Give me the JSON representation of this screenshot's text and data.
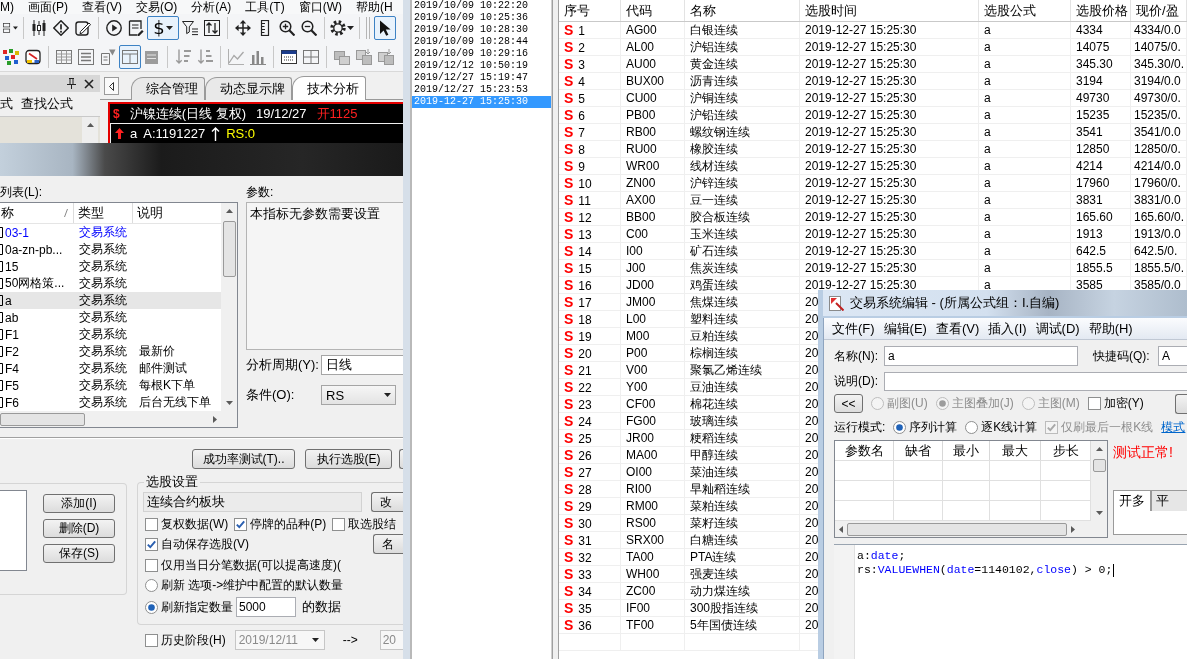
{
  "menu_bar": {
    "items": [
      "M)",
      "画面(P)",
      "查看(V)",
      "交易(O)",
      "分析(A)",
      "工具(T)",
      "窗口(W)",
      "帮助(H"
    ]
  },
  "toolbar_1": [
    {
      "pressed": false
    },
    {
      "pressed": false
    },
    {
      "pressed": false
    },
    {
      "pressed": false
    },
    {
      "pressed": false
    },
    {
      "pressed": false
    },
    {
      "label": "$",
      "pressed": true
    },
    {
      "pressed": false
    },
    {
      "pressed": false
    },
    {
      "pressed": false
    },
    {
      "pressed": false
    },
    {
      "pressed": false
    },
    {
      "pressed": false
    },
    {
      "pressed": false
    },
    {
      "pressed": true
    }
  ],
  "toolbar_2": [
    {
      "pressed": false
    },
    {
      "pressed": false
    },
    {
      "pressed": false
    },
    {
      "pressed": false
    },
    {
      "pressed": false
    },
    {
      "pressed": true
    },
    {
      "pressed": false
    },
    {
      "pressed": false
    },
    {
      "pressed": false
    },
    {
      "pressed": false
    },
    {
      "pressed": false
    },
    {
      "pressed": false
    },
    {
      "pressed": false
    },
    {
      "pressed": false
    },
    {
      "pressed": false
    },
    {
      "pressed": false
    }
  ],
  "side_panel": {
    "labels": [
      "式",
      "查找公式"
    ]
  },
  "tabs": [
    {
      "label": "综合管理",
      "selected": false
    },
    {
      "label": "动态显示牌",
      "selected": false
    },
    {
      "label": "技术分析",
      "selected": true
    }
  ],
  "chart_header": {
    "marker": "$",
    "title": "沪镍连续(日线 复权)",
    "date": "19/12/27",
    "open": "开1125",
    "formula": "a",
    "value": "A:1191227",
    "signal": "RS:0"
  },
  "formula_dialog": {
    "list_label": "列表(L):",
    "columns": [
      "称",
      "类型",
      "说明"
    ],
    "rows": [
      {
        "name": "03-1",
        "type": "交易系统",
        "current": true,
        "selected": false
      },
      {
        "name": "0a-zn-pb...",
        "type": "交易系统",
        "current": false,
        "selected": false
      },
      {
        "name": "15",
        "type": "交易系统",
        "current": false,
        "selected": false
      },
      {
        "name": "50网格策...",
        "type": "交易系统",
        "current": false,
        "selected": false
      },
      {
        "name": "a",
        "type": "交易系统",
        "current": false,
        "selected": true
      },
      {
        "name": "ab",
        "type": "交易系统",
        "current": false,
        "selected": false
      },
      {
        "name": "F1",
        "type": "交易系统",
        "current": false,
        "selected": false
      },
      {
        "name": "F2",
        "type": "交易系统",
        "note": "最新价",
        "current": false,
        "selected": false
      },
      {
        "name": "F4",
        "type": "交易系统",
        "note": "邮件测试",
        "current": false,
        "selected": false
      },
      {
        "name": "F5",
        "type": "交易系统",
        "note": "每根K下单",
        "current": false,
        "selected": false
      },
      {
        "name": "F6",
        "type": "交易系统",
        "note": "后台无线下单",
        "current": false,
        "selected": false
      }
    ],
    "params_label": "参数:",
    "params_text": "本指标无参数需要设置",
    "period": {
      "label": "分析周期(Y):",
      "value": "日线"
    },
    "condition": {
      "label": "条件(O):",
      "value": "RS"
    },
    "actions": [
      "成功率测试(T)..",
      "执行选股(E)"
    ],
    "list_buttons": [
      "添加(I)",
      "删除(D)",
      "保存(S)"
    ],
    "selection": {
      "title": "选股设置",
      "block": "连续合约板块",
      "change_button": "改",
      "name_button": "名",
      "options": [
        {
          "label": "复权数据(W)",
          "checked": false
        },
        {
          "label": "停牌的品种(P)",
          "checked": true
        },
        {
          "label": "取选股结",
          "checked": false
        }
      ],
      "auto_save": {
        "label": "自动保存选股(V)",
        "checked": true
      },
      "tick_data": {
        "label": "仅用当日分笔数据(可以提高速度)(",
        "checked": false
      },
      "refresh": [
        {
          "label": "刷新 选项->维护中配置的默认数量",
          "selected": false
        },
        {
          "label": "刷新指定数量",
          "selected": true,
          "count": "5000",
          "suffix": "的数据"
        }
      ]
    },
    "history": {
      "label": "历史阶段(H)",
      "checked": false,
      "disabled": true,
      "from": "2019/12/11",
      "arrow": "-->",
      "to": "20"
    }
  },
  "history_list": [
    {
      "text": "2019/10/09 10:22:20",
      "selected": false
    },
    {
      "text": "2019/10/09 10:25:36",
      "selected": false
    },
    {
      "text": "2019/10/09 10:28:30",
      "selected": false
    },
    {
      "text": "2019/10/09 10:28:44",
      "selected": false
    },
    {
      "text": "2019/10/09 10:29:16",
      "selected": false
    },
    {
      "text": "2019/12/12 10:50:19",
      "selected": false
    },
    {
      "text": "2019/12/27 15:19:47",
      "selected": false
    },
    {
      "text": "2019/12/27 15:23:53",
      "selected": false
    },
    {
      "text": "2019-12-27 15:25:30",
      "selected": true
    }
  ],
  "results_table": {
    "columns": [
      "序号",
      "代码",
      "名称",
      "选股时间",
      "选股公式",
      "选股价格",
      "现价/盈"
    ],
    "rows": [
      {
        "mark": "S",
        "no": "1",
        "code": "AG00",
        "name": "白银连续",
        "time": "2019-12-27 15:25:30",
        "formula": "a",
        "price": "4334",
        "current": "4334/0.0"
      },
      {
        "mark": "S",
        "no": "2",
        "code": "AL00",
        "name": "沪铝连续",
        "time": "2019-12-27 15:25:30",
        "formula": "a",
        "price": "14075",
        "current": "14075/0."
      },
      {
        "mark": "S",
        "no": "3",
        "code": "AU00",
        "name": "黄金连续",
        "time": "2019-12-27 15:25:30",
        "formula": "a",
        "price": "345.30",
        "current": "345.30/0."
      },
      {
        "mark": "S",
        "no": "4",
        "code": "BUX00",
        "name": "沥青连续",
        "time": "2019-12-27 15:25:30",
        "formula": "a",
        "price": "3194",
        "current": "3194/0.0"
      },
      {
        "mark": "S",
        "no": "5",
        "code": "CU00",
        "name": "沪铜连续",
        "time": "2019-12-27 15:25:30",
        "formula": "a",
        "price": "49730",
        "current": "49730/0."
      },
      {
        "mark": "S",
        "no": "6",
        "code": "PB00",
        "name": "沪铅连续",
        "time": "2019-12-27 15:25:30",
        "formula": "a",
        "price": "15235",
        "current": "15235/0."
      },
      {
        "mark": "S",
        "no": "7",
        "code": "RB00",
        "name": "螺纹钢连续",
        "time": "2019-12-27 15:25:30",
        "formula": "a",
        "price": "3541",
        "current": "3541/0.0"
      },
      {
        "mark": "S",
        "no": "8",
        "code": "RU00",
        "name": "橡胶连续",
        "time": "2019-12-27 15:25:30",
        "formula": "a",
        "price": "12850",
        "current": "12850/0."
      },
      {
        "mark": "S",
        "no": "9",
        "code": "WR00",
        "name": "线材连续",
        "time": "2019-12-27 15:25:30",
        "formula": "a",
        "price": "4214",
        "current": "4214/0.0"
      },
      {
        "mark": "S",
        "no": "10",
        "code": "ZN00",
        "name": "沪锌连续",
        "time": "2019-12-27 15:25:30",
        "formula": "a",
        "price": "17960",
        "current": "17960/0."
      },
      {
        "mark": "S",
        "no": "11",
        "code": "AX00",
        "name": "豆一连续",
        "time": "2019-12-27 15:25:30",
        "formula": "a",
        "price": "3831",
        "current": "3831/0.0"
      },
      {
        "mark": "S",
        "no": "12",
        "code": "BB00",
        "name": "胶合板连续",
        "time": "2019-12-27 15:25:30",
        "formula": "a",
        "price": "165.60",
        "current": "165.60/0."
      },
      {
        "mark": "S",
        "no": "13",
        "code": "C00",
        "name": "玉米连续",
        "time": "2019-12-27 15:25:30",
        "formula": "a",
        "price": "1913",
        "current": "1913/0.0"
      },
      {
        "mark": "S",
        "no": "14",
        "code": "I00",
        "name": "矿石连续",
        "time": "2019-12-27 15:25:30",
        "formula": "a",
        "price": "642.5",
        "current": "642.5/0."
      },
      {
        "mark": "S",
        "no": "15",
        "code": "J00",
        "name": "焦炭连续",
        "time": "2019-12-27 15:25:30",
        "formula": "a",
        "price": "1855.5",
        "current": "1855.5/0."
      },
      {
        "mark": "S",
        "no": "16",
        "code": "JD00",
        "name": "鸡蛋连续",
        "time": "2019-12-27 15:25:30",
        "formula": "a",
        "price": "3585",
        "current": "3585/0.0"
      },
      {
        "mark": "S",
        "no": "17",
        "code": "JM00",
        "name": "焦煤连续",
        "time": "20"
      },
      {
        "mark": "S",
        "no": "18",
        "code": "L00",
        "name": "塑料连续",
        "time": "20"
      },
      {
        "mark": "S",
        "no": "19",
        "code": "M00",
        "name": "豆粕连续",
        "time": "20"
      },
      {
        "mark": "S",
        "no": "20",
        "code": "P00",
        "name": "棕榈连续",
        "time": "20"
      },
      {
        "mark": "S",
        "no": "21",
        "code": "V00",
        "name": "聚氯乙烯连续",
        "time": "20"
      },
      {
        "mark": "S",
        "no": "22",
        "code": "Y00",
        "name": "豆油连续",
        "time": "20"
      },
      {
        "mark": "S",
        "no": "23",
        "code": "CF00",
        "name": "棉花连续",
        "time": "20"
      },
      {
        "mark": "S",
        "no": "24",
        "code": "FG00",
        "name": "玻璃连续",
        "time": "20"
      },
      {
        "mark": "S",
        "no": "25",
        "code": "JR00",
        "name": "粳稻连续",
        "time": "20"
      },
      {
        "mark": "S",
        "no": "26",
        "code": "MA00",
        "name": "甲醇连续",
        "time": "20"
      },
      {
        "mark": "S",
        "no": "27",
        "code": "OI00",
        "name": "菜油连续",
        "time": "20"
      },
      {
        "mark": "S",
        "no": "28",
        "code": "RI00",
        "name": "早籼稻连续",
        "time": "20"
      },
      {
        "mark": "S",
        "no": "29",
        "code": "RM00",
        "name": "菜粕连续",
        "time": "20"
      },
      {
        "mark": "S",
        "no": "30",
        "code": "RS00",
        "name": "菜籽连续",
        "time": "20"
      },
      {
        "mark": "S",
        "no": "31",
        "code": "SRX00",
        "name": "白糖连续",
        "time": "20"
      },
      {
        "mark": "S",
        "no": "32",
        "code": "TA00",
        "name": "PTA连续",
        "time": "20"
      },
      {
        "mark": "S",
        "no": "33",
        "code": "WH00",
        "name": "强麦连续",
        "time": "20"
      },
      {
        "mark": "S",
        "no": "34",
        "code": "ZC00",
        "name": "动力煤连续",
        "time": "20"
      },
      {
        "mark": "S",
        "no": "35",
        "code": "IF00",
        "name": "300股指连续",
        "time": "20"
      },
      {
        "mark": "S",
        "no": "36",
        "code": "TF00",
        "name": "5年国债连续",
        "time": "20"
      }
    ]
  },
  "editor_dialog": {
    "title": "交易系统编辑 - (所属公式组：I.自编)",
    "menu": [
      "文件(F)",
      "编辑(E)",
      "查看(V)",
      "插入(I)",
      "调试(D)",
      "帮助(H)"
    ],
    "name": {
      "label": "名称(N):",
      "value": "a"
    },
    "shortcut": {
      "label": "快捷码(Q):",
      "value": "A"
    },
    "description": {
      "label": "说明(D):"
    },
    "collapse_button": "<<",
    "chart_options": [
      {
        "label": "副图(U)",
        "kind": "radio",
        "selected": false,
        "disabled": true
      },
      {
        "label": "主图叠加(J)",
        "kind": "radio",
        "selected": true,
        "disabled": true
      },
      {
        "label": "主图(M)",
        "kind": "radio",
        "selected": false,
        "disabled": true
      },
      {
        "label": "加密(Y)",
        "kind": "checkbox",
        "checked": false,
        "disabled": false
      }
    ],
    "run_mode": {
      "label": "运行模式:",
      "options": [
        {
          "label": "序列计算",
          "kind": "radio",
          "selected": true,
          "disabled": false
        },
        {
          "label": "逐K线计算",
          "kind": "radio",
          "selected": false,
          "disabled": false
        },
        {
          "label": "仅刷最后一根K线",
          "kind": "checkbox",
          "checked": true,
          "disabled": true
        }
      ],
      "link": "模式"
    },
    "param_columns": [
      "参数名",
      "缺省",
      "最小",
      "最大",
      "步长"
    ],
    "status": "测试正常!",
    "signal_tabs": [
      {
        "label": "开多",
        "selected": true
      },
      {
        "label": "平",
        "selected": false
      }
    ],
    "code": [
      [
        {
          "text": "a:",
          "kind": "plain"
        },
        {
          "text": "date",
          "kind": "keyword"
        },
        {
          "text": ";",
          "kind": "plain"
        }
      ],
      [
        {
          "text": "rs:",
          "kind": "plain"
        },
        {
          "text": "VALUEWHEN",
          "kind": "keyword"
        },
        {
          "text": "(",
          "kind": "plain"
        },
        {
          "text": "date",
          "kind": "keyword"
        },
        {
          "text": "=1140102,",
          "kind": "plain"
        },
        {
          "text": "close",
          "kind": "keyword"
        },
        {
          "text": ") > 0;",
          "kind": "plain"
        }
      ]
    ]
  }
}
